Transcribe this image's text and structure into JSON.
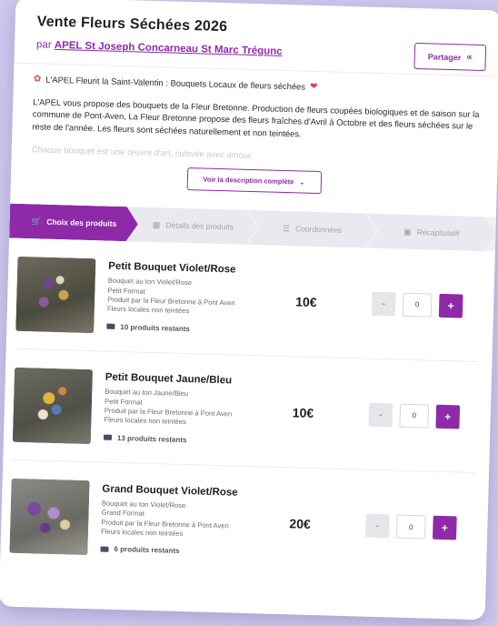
{
  "header": {
    "title": "Vente Fleurs Séchées 2026",
    "by_prefix": "par",
    "organization": "APEL St Joseph Concarneau St Marc Trégunc",
    "share_label": "Partager"
  },
  "description": {
    "headline": "L'APEL Fleurit la Saint-Valentin : Bouquets Locaux de fleurs séchées",
    "body": "L'APEL vous propose des bouquets de la Fleur Bretonne. Production de fleurs coupées biologiques et de saison sur la commune de Pont-Aven, La Fleur Bretonne propose des fleurs fraîches d'Avril à Octobre et des fleurs séchées sur le reste de l'année. Les fleurs sont séchées naturellement et non teintées.",
    "faded": "Chaque bouquet est une œuvre d'art, cultivée avec amour.",
    "more_label": "Voir la description complète"
  },
  "steps": [
    {
      "label": "Choix des produits",
      "icon": "cart-icon",
      "active": true
    },
    {
      "label": "Détails des produits",
      "icon": "boxes-icon",
      "active": false
    },
    {
      "label": "Coordonnées",
      "icon": "list-icon",
      "active": false
    },
    {
      "label": "Récapitulatif",
      "icon": "receipt-icon",
      "active": false
    }
  ],
  "products": [
    {
      "name": "Petit Bouquet Violet/Rose",
      "lines": [
        "Bouquet au ton Violet/Rose",
        "Petit Format",
        "Produit par la Fleur Bretonne à Pont Aven",
        "Fleurs locales non teintées"
      ],
      "stock": "10 produits restants",
      "price": "10€",
      "quantity": "0"
    },
    {
      "name": "Petit Bouquet Jaune/Bleu",
      "lines": [
        "Bouquet au ton Jaune/Bleu",
        "Petit Format",
        "Produit par la Fleur Bretonne à Pont Aven",
        "Fleurs locales non teintées"
      ],
      "stock": "13 produits restants",
      "price": "10€",
      "quantity": "0"
    },
    {
      "name": "Grand Bouquet Violet/Rose",
      "lines": [
        "Bouquet au ton Violet/Rose",
        "Grand Format",
        "Produit par la Fleur Bretonne à Pont Aven",
        "Fleurs locales non teintées"
      ],
      "stock": "6 produits restants",
      "price": "20€",
      "quantity": "0"
    }
  ],
  "qty_controls": {
    "minus": "-",
    "plus": "+"
  },
  "colors": {
    "accent": "#8e2aa8",
    "background": "#cfc9ee"
  }
}
